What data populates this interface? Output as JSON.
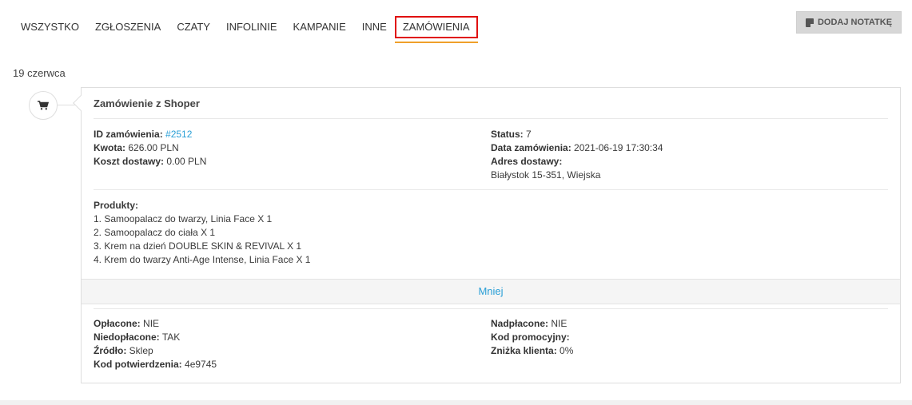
{
  "tabs": [
    "WSZYSTKO",
    "ZGŁOSZENIA",
    "CZATY",
    "INFOLINIE",
    "KAMPANIE",
    "INNE",
    "ZAMÓWIENIA"
  ],
  "active_tab": "ZAMÓWIENIA",
  "add_note_label": "DODAJ NOTATKĘ",
  "date_label": "19 czerwca",
  "card": {
    "title": "Zamówienie z Shoper",
    "order_id_label": "ID zamówienia:",
    "order_id_value": "#2512",
    "amount_label": "Kwota:",
    "amount_value": "626.00 PLN",
    "shipping_label": "Koszt dostawy:",
    "shipping_value": "0.00 PLN",
    "status_label": "Status:",
    "status_value": "7",
    "order_date_label": "Data zamówienia:",
    "order_date_value": "2021-06-19 17:30:34",
    "address_label": "Adres dostawy:",
    "address_value": "Białystok 15-351, Wiejska",
    "products_label": "Produkty:",
    "products": [
      "1. Samoopalacz do twarzy, Linia Face X 1",
      "2. Samoopalacz do ciała X 1",
      "3. Krem na dzień DOUBLE SKIN & REVIVAL X 1",
      "4. Krem do twarzy Anti-Age Intense, Linia Face X 1"
    ],
    "less_label": "Mniej",
    "paid_label": "Opłacone:",
    "paid_value": "NIE",
    "underpaid_label": "Niedopłacone:",
    "underpaid_value": "TAK",
    "source_label": "Źródło:",
    "source_value": "Sklep",
    "confirm_code_label": "Kod potwierdzenia:",
    "confirm_code_value": "4e9745",
    "overpaid_label": "Nadpłacone:",
    "overpaid_value": "NIE",
    "promo_label": "Kod promocyjny:",
    "promo_value": "",
    "discount_label": "Zniżka klienta:",
    "discount_value": "0%"
  },
  "icons": {
    "timeline": "cart-icon",
    "note": "note-icon"
  },
  "colors": {
    "link": "#2a9fd6",
    "active_tab_border": "#e01010",
    "active_tab_underline": "#f0a02a"
  }
}
